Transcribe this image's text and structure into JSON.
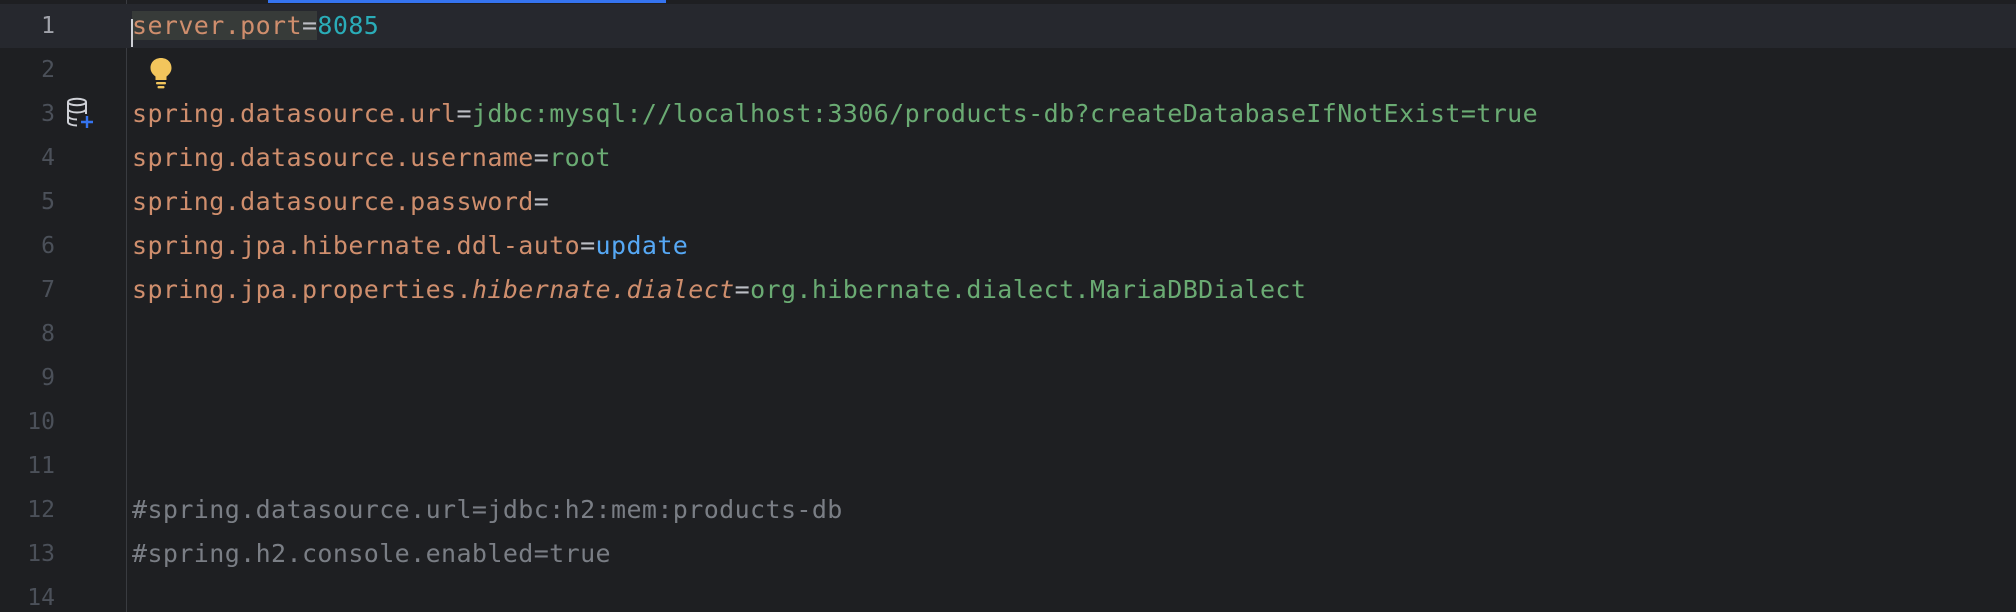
{
  "editor": {
    "lines": [
      {
        "number": "1",
        "key": "server.port",
        "eq": "=",
        "value": "8085"
      },
      {
        "number": "2"
      },
      {
        "number": "3",
        "key": "spring.datasource.url",
        "eq": "=",
        "value": "jdbc:mysql://localhost:3306/products-db?createDatabaseIfNotExist=true"
      },
      {
        "number": "4",
        "key": "spring.datasource.username",
        "eq": "=",
        "value": "root"
      },
      {
        "number": "5",
        "key": "spring.datasource.password",
        "eq": "="
      },
      {
        "number": "6",
        "key": "spring.jpa.hibernate.ddl-auto",
        "eq": "=",
        "value": "update"
      },
      {
        "number": "7",
        "key_prefix": "spring.jpa.properties.",
        "key_italic": "hibernate.dialect",
        "eq": "=",
        "value": "org.hibernate.dialect.MariaDBDialect"
      },
      {
        "number": "8"
      },
      {
        "number": "9"
      },
      {
        "number": "10"
      },
      {
        "number": "11"
      },
      {
        "number": "12",
        "comment": "#spring.datasource.url=jdbc:h2:mem:products-db"
      },
      {
        "number": "13",
        "comment": "#spring.h2.console.enabled=true"
      },
      {
        "number": "14"
      }
    ]
  },
  "icons": {
    "gutter_line3": "database-icon",
    "intention": "lightbulb-icon"
  },
  "colors": {
    "background": "#1e1f22",
    "current_line": "#26282e",
    "key": "#cf8e6d",
    "value": "#6aab73",
    "number": "#2aacb8",
    "keyword_value": "#56a8f5",
    "comment": "#7a7e85",
    "accent": "#3574f0"
  }
}
